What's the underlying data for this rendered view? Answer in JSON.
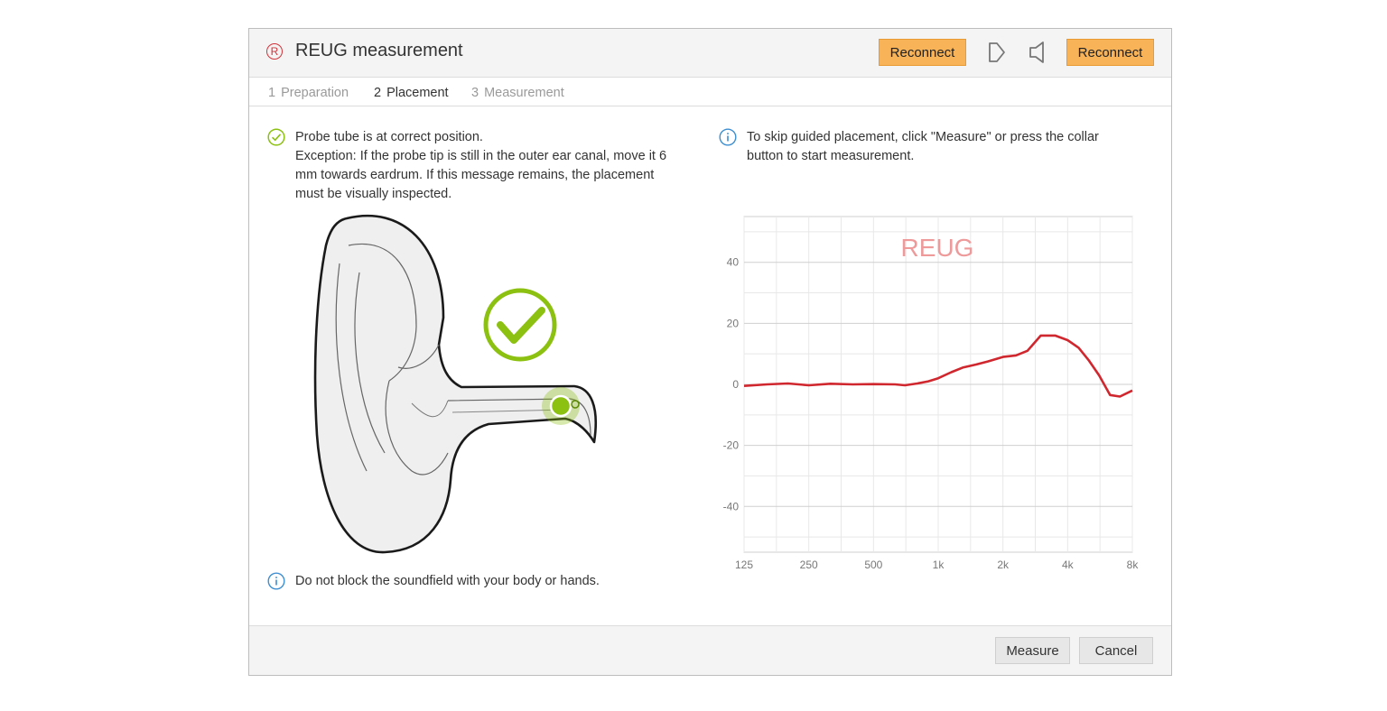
{
  "window": {
    "title": "REUG measurement",
    "title_icon_glyph": "R"
  },
  "header": {
    "reconnect_left": "Reconnect",
    "reconnect_right": "Reconnect"
  },
  "steps": [
    {
      "num": "1",
      "label": "Preparation"
    },
    {
      "num": "2",
      "label": "Placement"
    },
    {
      "num": "3",
      "label": "Measurement"
    }
  ],
  "messages": {
    "status_line1": "Probe tube is at correct position.",
    "status_line2": "Exception: If the probe tip is still in the outer ear canal, move it 6",
    "status_line3": "mm towards eardrum. If this message remains, the placement",
    "status_line4": "must be visually inspected.",
    "skip_line1": "To skip guided placement, click \"Measure\" or press the collar",
    "skip_line2": "button to start measurement.",
    "soundfield": "Do not block the soundfield with your body or hands."
  },
  "footer": {
    "measure": "Measure",
    "cancel": "Cancel"
  },
  "colors": {
    "accent_orange": "#f8b358",
    "curve_red": "#d0272f",
    "check_green": "#8cc011",
    "info_blue": "#3d8fd1"
  },
  "chart_data": {
    "type": "line",
    "title": "REUG",
    "x_ticks": [
      "125",
      "250",
      "500",
      "1k",
      "2k",
      "4k",
      "8k"
    ],
    "y_ticks": [
      "40",
      "20",
      "0",
      "-20",
      "-40"
    ],
    "xlim": [
      125,
      8000
    ],
    "ylim": [
      -55,
      55
    ],
    "xscale": "log",
    "grid": true,
    "series": [
      {
        "x": [
          125,
          160,
          200,
          250,
          315,
          400,
          500,
          630,
          700,
          800,
          900,
          1000,
          1150,
          1300,
          1500,
          1700,
          2000,
          2300,
          2600,
          3000,
          3500,
          4000,
          4500,
          5000,
          5600,
          6300,
          7000,
          8000
        ],
        "y": [
          -0.5,
          0,
          0.3,
          -0.3,
          0.2,
          0,
          0.1,
          0,
          -0.3,
          0.3,
          1,
          2,
          4,
          5.5,
          6.5,
          7.5,
          9,
          9.5,
          11,
          16,
          16,
          14.5,
          12,
          8,
          3,
          -3.5,
          -4,
          -2
        ]
      }
    ]
  }
}
